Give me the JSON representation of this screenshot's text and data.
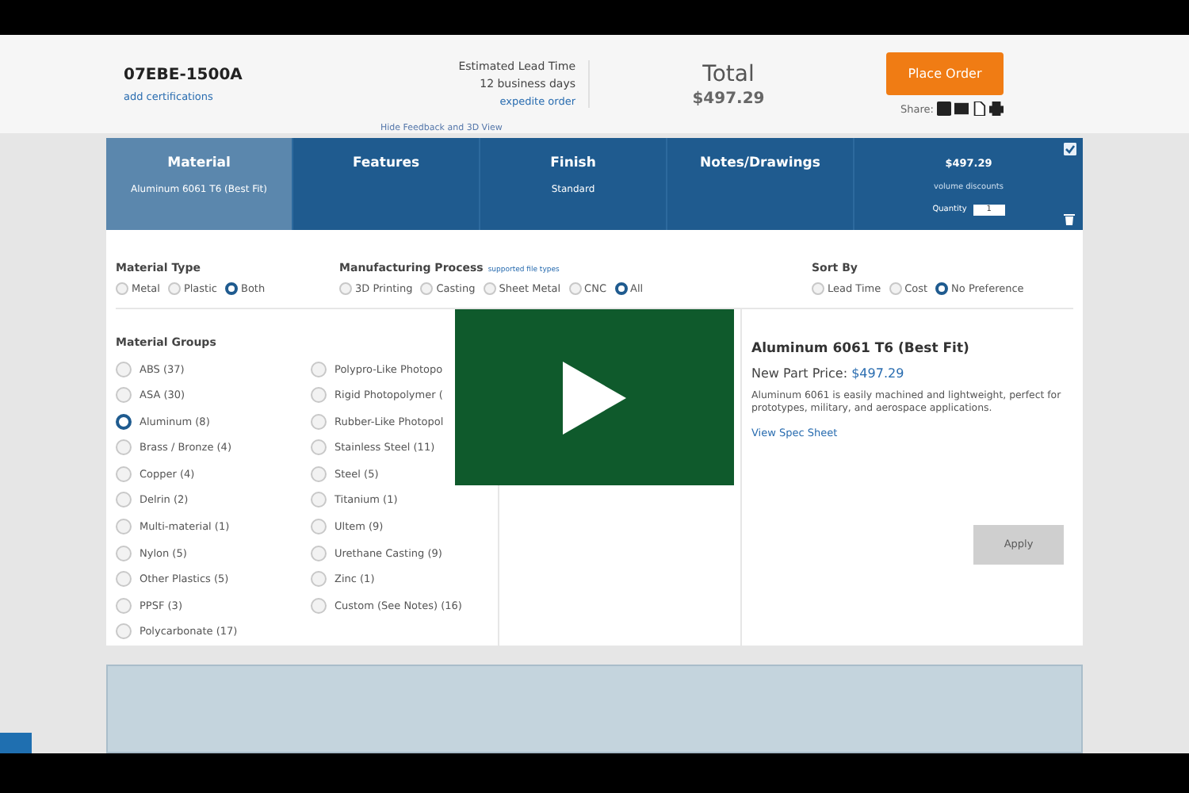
{
  "header": {
    "part_number": "07EBE-1500A",
    "certifications_link": "add certifications",
    "lead_time_label": "Estimated Lead Time",
    "lead_time_value": "12 business days",
    "expedite_link": "expedite order",
    "total_label": "Total",
    "total_value": "$497.29",
    "place_order": "Place Order",
    "share_label": "Share:"
  },
  "feedback_link": "Hide Feedback and 3D View",
  "tabs": [
    {
      "title": "Material",
      "subtitle": "Aluminum 6061 T6 (Best Fit)",
      "selected": true
    },
    {
      "title": "Features",
      "selected": false
    },
    {
      "title": "Finish",
      "subtitle": "Standard",
      "selected": false
    },
    {
      "title": "Notes/Drawings",
      "selected": false
    }
  ],
  "price_tab": {
    "price": "$497.29",
    "discount_link": "volume discounts",
    "quantity_label": "Quantity",
    "quantity": "1",
    "checked": true
  },
  "material_type": {
    "label": "Material Type",
    "options": [
      {
        "label": "Metal",
        "selected": false
      },
      {
        "label": "Plastic",
        "selected": false
      },
      {
        "label": "Both",
        "selected": true
      }
    ]
  },
  "manufacturing_process": {
    "label": "Manufacturing Process",
    "link": "supported file types",
    "options": [
      {
        "label": "3D Printing",
        "selected": false
      },
      {
        "label": "Casting",
        "selected": false
      },
      {
        "label": "Sheet Metal",
        "selected": false
      },
      {
        "label": "CNC",
        "selected": false
      },
      {
        "label": "All",
        "selected": true
      }
    ]
  },
  "sort_by": {
    "label": "Sort By",
    "options": [
      {
        "label": "Lead Time",
        "selected": false
      },
      {
        "label": "Cost",
        "selected": false
      },
      {
        "label": "No Preference",
        "selected": true
      }
    ]
  },
  "material_groups": {
    "label": "Material Groups",
    "columns": [
      [
        {
          "label": "ABS (37)",
          "selected": false
        },
        {
          "label": "ASA (30)",
          "selected": false
        },
        {
          "label": "Aluminum (8)",
          "selected": true
        },
        {
          "label": "Brass / Bronze (4)",
          "selected": false
        },
        {
          "label": "Copper (4)",
          "selected": false
        },
        {
          "label": "Delrin (2)",
          "selected": false
        },
        {
          "label": "Multi-material (1)",
          "selected": false
        },
        {
          "label": "Nylon (5)",
          "selected": false
        },
        {
          "label": "Other Plastics (5)",
          "selected": false
        },
        {
          "label": "PPSF (3)",
          "selected": false
        },
        {
          "label": "Polycarbonate (17)",
          "selected": false
        }
      ],
      [
        {
          "label": "Polypro-Like Photopo",
          "selected": false
        },
        {
          "label": "Rigid Photopolymer (",
          "selected": false
        },
        {
          "label": "Rubber-Like Photopol",
          "selected": false
        },
        {
          "label": "Stainless Steel (11)",
          "selected": false
        },
        {
          "label": "Steel (5)",
          "selected": false
        },
        {
          "label": "Titanium (1)",
          "selected": false
        },
        {
          "label": "Ultem (9)",
          "selected": false
        },
        {
          "label": "Urethane Casting (9)",
          "selected": false
        },
        {
          "label": "Zinc (1)",
          "selected": false
        },
        {
          "label": "Custom (See Notes) (16)",
          "selected": false
        }
      ]
    ]
  },
  "detail": {
    "title": "Aluminum 6061 T6 (Best Fit)",
    "price_label": "New Part Price:",
    "price": "$497.29",
    "description": "Aluminum 6061 is easily machined and lightweight, perfect for prototypes, military, and aerospace applications.",
    "spec_link": "View Spec Sheet",
    "apply": {
      "label": "Apply",
      "disabled": true
    }
  }
}
